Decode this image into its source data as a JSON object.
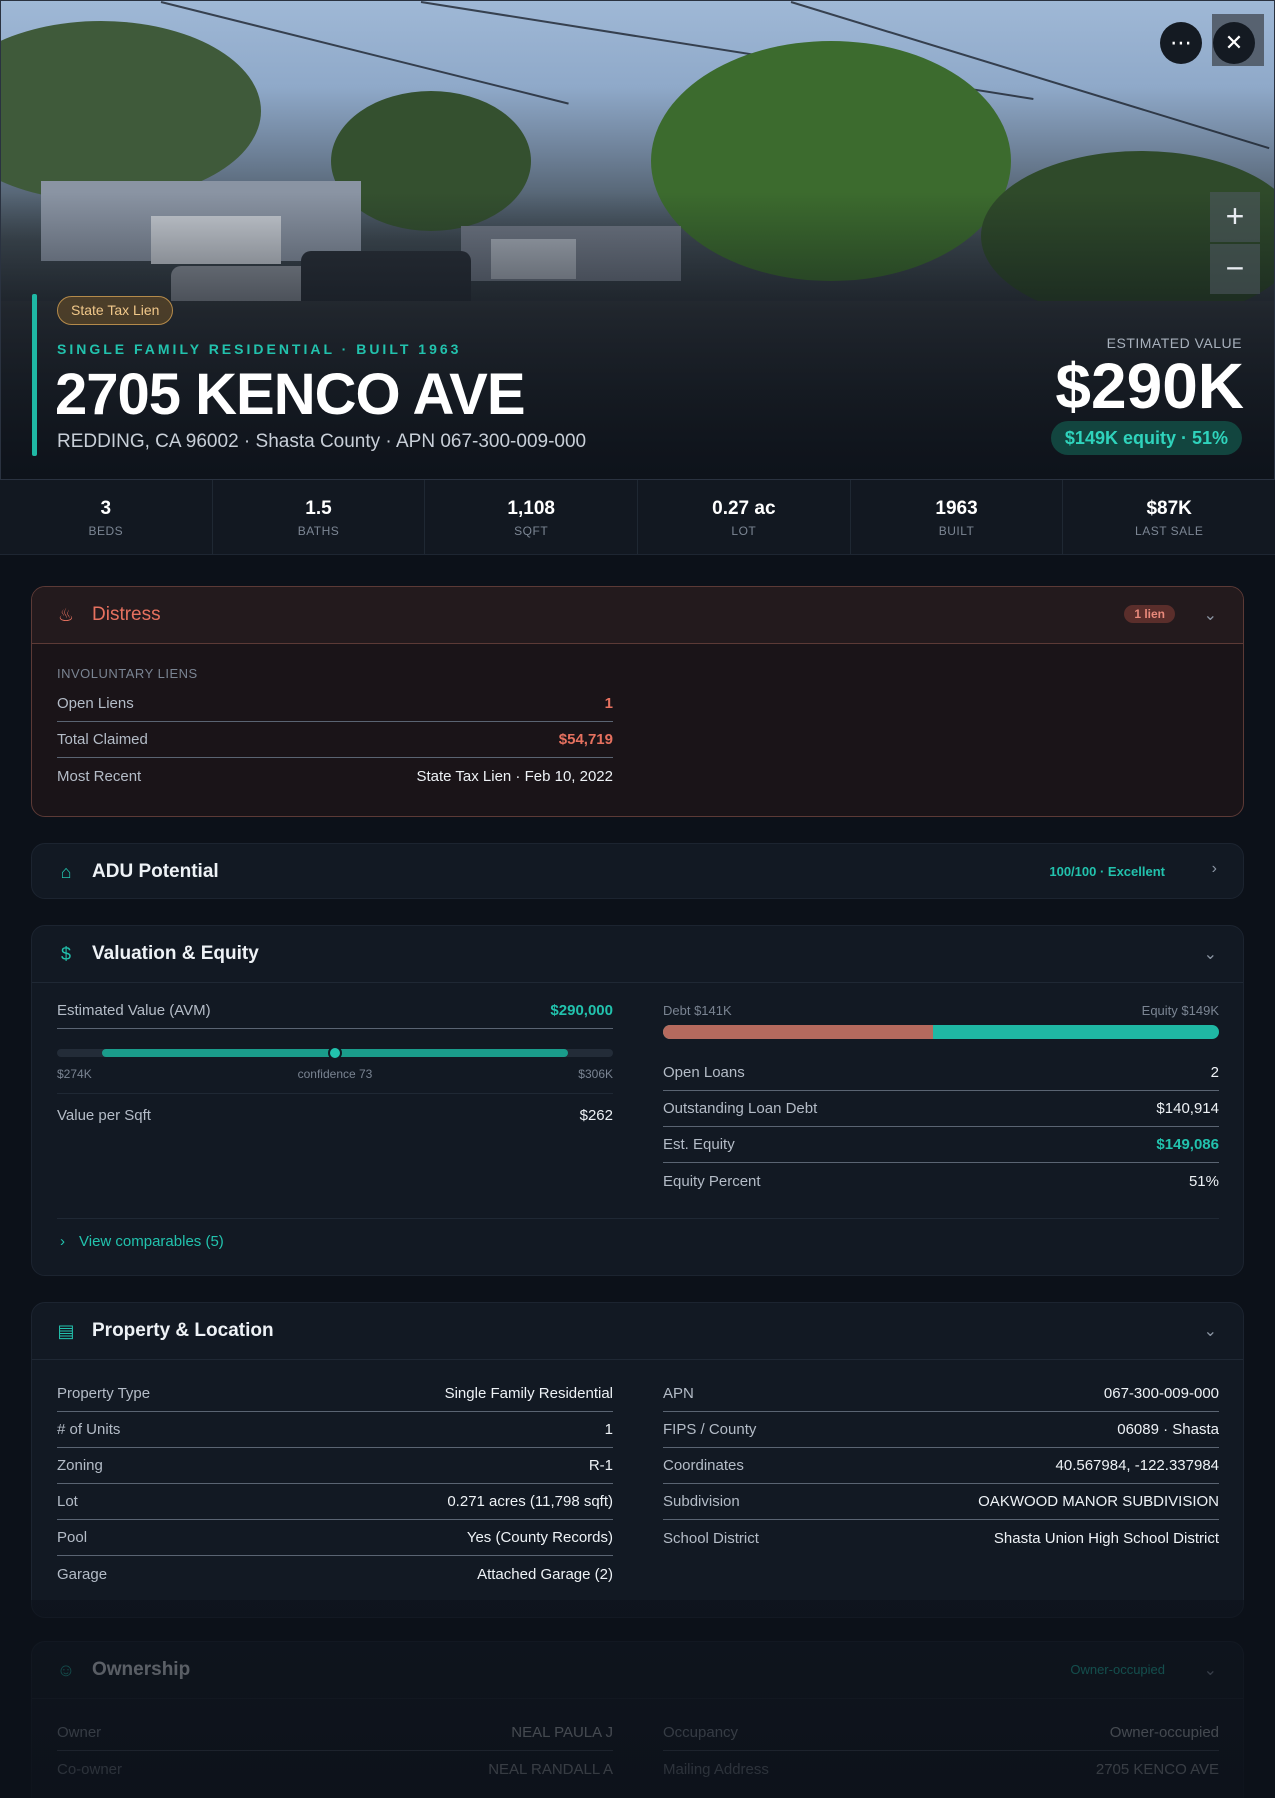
{
  "hero": {
    "lien_badge": "State Tax Lien",
    "kicker": "SINGLE FAMILY RESIDENTIAL · BUILT 1963",
    "address": "2705 KENCO AVE",
    "subaddress": "REDDING, CA 96002 · Shasta County · APN 067-300-009-000",
    "est_label": "ESTIMATED VALUE",
    "est_value": "$290K",
    "equity_pill": "$149K equity · 51%",
    "more_icon": "more-horizontal-icon",
    "close_icon": "close-icon",
    "zoom_in_label": "+",
    "zoom_out_label": "−"
  },
  "stats": [
    {
      "value": "3",
      "label": "BEDS"
    },
    {
      "value": "1.5",
      "label": "BATHS"
    },
    {
      "value": "1,108",
      "label": "SQFT"
    },
    {
      "value": "0.27 ac",
      "label": "LOT"
    },
    {
      "value": "1963",
      "label": "BUILT"
    },
    {
      "value": "$87K",
      "label": "LAST SALE"
    }
  ],
  "distress": {
    "title": "Distress",
    "badge": "1 lien",
    "section_label": "INVOLUNTARY LIENS",
    "rows": [
      {
        "label": "Open Liens",
        "value": "1"
      },
      {
        "label": "Total Claimed",
        "value": "$54,719"
      },
      {
        "label": "Most Recent",
        "value": "State Tax Lien · Feb 10, 2022"
      }
    ]
  },
  "adu": {
    "title": "ADU Potential",
    "score": "100/100 · Excellent"
  },
  "valuation": {
    "title": "Valuation & Equity",
    "avm_label": "Estimated Value (AVM)",
    "avm_value": "$290,000",
    "range_low": "$274K",
    "range_mid": "confidence 73",
    "range_high": "$306K",
    "confidence": 73,
    "vps_label": "Value per Sqft",
    "vps_value": "$262",
    "debt_label": "Debt $141K",
    "equity_label": "Equity $149K",
    "debt_fraction": 0.486,
    "rows": [
      {
        "label": "Open Loans",
        "value": "2"
      },
      {
        "label": "Outstanding Loan Debt",
        "value": "$140,914"
      },
      {
        "label": "Est. Equity",
        "value": "$149,086"
      },
      {
        "label": "Equity Percent",
        "value": "51%"
      }
    ],
    "comparables_link": "View comparables (5)"
  },
  "property": {
    "title": "Property & Location",
    "left": [
      {
        "label": "Property Type",
        "value": "Single Family Residential"
      },
      {
        "label": "# of Units",
        "value": "1"
      },
      {
        "label": "Zoning",
        "value": "R-1"
      },
      {
        "label": "Lot",
        "value": "0.271 acres (11,798 sqft)"
      },
      {
        "label": "Pool",
        "value": "Yes (County Records)"
      },
      {
        "label": "Garage",
        "value": "Attached Garage (2)"
      }
    ],
    "right": [
      {
        "label": "APN",
        "value": "067-300-009-000"
      },
      {
        "label": "FIPS / County",
        "value": "06089 · Shasta"
      },
      {
        "label": "Coordinates",
        "value": "40.567984, -122.337984"
      },
      {
        "label": "Subdivision",
        "value": "OAKWOOD MANOR SUBDIVISION"
      },
      {
        "label": "School District",
        "value": "Shasta Union High School District"
      }
    ]
  },
  "ownership": {
    "title": "Ownership",
    "badge": "Owner-occupied",
    "left": [
      {
        "label": "Owner",
        "value": "NEAL PAULA J"
      },
      {
        "label": "Co-owner",
        "value": "NEAL RANDALL A"
      }
    ],
    "right": [
      {
        "label": "Occupancy",
        "value": "Owner-occupied"
      },
      {
        "label": "Mailing Address",
        "value": "2705 KENCO AVE"
      }
    ]
  },
  "colors": {
    "accent": "#22c2ad",
    "distress": "#e6715f",
    "debt_bar": "#b56a5e",
    "background": "#0c1119"
  }
}
